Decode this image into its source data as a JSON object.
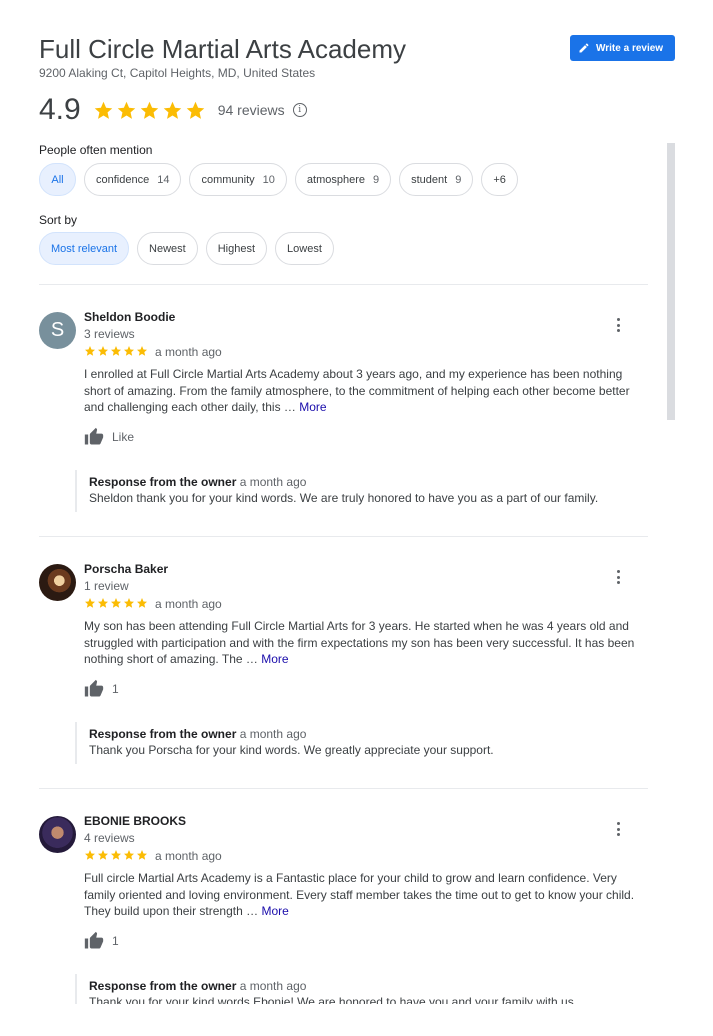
{
  "place": {
    "name": "Full Circle Martial Arts Academy",
    "address": "9200 Alaking Ct, Capitol Heights, MD, United States",
    "write_review_label": "Write a review",
    "rating": "4.9",
    "rating_stars": 5,
    "review_count": "94 reviews"
  },
  "mentions": {
    "label": "People often mention",
    "chips": [
      {
        "label": "All",
        "count": ""
      },
      {
        "label": "confidence",
        "count": "14"
      },
      {
        "label": "community",
        "count": "10"
      },
      {
        "label": "atmosphere",
        "count": "9"
      },
      {
        "label": "student",
        "count": "9"
      },
      {
        "label": "+6",
        "count": ""
      }
    ]
  },
  "sort": {
    "label": "Sort by",
    "options": [
      "Most relevant",
      "Newest",
      "Highest",
      "Lowest"
    ],
    "selected": "Most relevant"
  },
  "colors": {
    "accent": "#1a73e8",
    "star": "#fbbc04",
    "link": "#1a0dab"
  },
  "reviews": [
    {
      "name": "Sheldon Boodie",
      "meta": "3 reviews",
      "avatar_letter": "S",
      "stars": 5,
      "date": "a month ago",
      "text": "I enrolled at Full Circle Martial Arts Academy about 3 years ago, and my experience has been nothing short of amazing. From the family atmosphere, to the commitment of helping each other become better and challenging each other daily, this …",
      "more_label": "More",
      "likes": "Like",
      "owner_title": "Response from the owner",
      "owner_date": "a month ago",
      "owner_text": "Sheldon thank you for your kind words. We are truly honored to have you as a part of our family."
    },
    {
      "name": "Porscha Baker",
      "meta": "1 review",
      "avatar_letter": "",
      "stars": 5,
      "date": "a month ago",
      "text": "My son has been attending Full Circle Martial Arts for 3 years.  He started when he was 4 years old and struggled with participation and with the firm expectations my son has been very successful. It has been nothing short of amazing.   The …",
      "more_label": "More",
      "likes": "1",
      "owner_title": "Response from the owner",
      "owner_date": "a month ago",
      "owner_text": "Thank you Porscha for your kind words. We greatly appreciate your support."
    },
    {
      "name": "EBONIE BROOKS",
      "meta": "4 reviews",
      "avatar_letter": "",
      "stars": 5,
      "date": "a month ago",
      "text": "Full circle Martial Arts Academy is a Fantastic place for your child to grow and learn confidence. Very family oriented and loving environment. Every staff member takes the time out to get to know your child. They build upon their strength …",
      "more_label": "More",
      "likes": "1",
      "owner_title": "Response from the owner",
      "owner_date": "a month ago",
      "owner_text": "Thank you for your kind words Ebonie! We are honored to have you and your family with us."
    }
  ]
}
